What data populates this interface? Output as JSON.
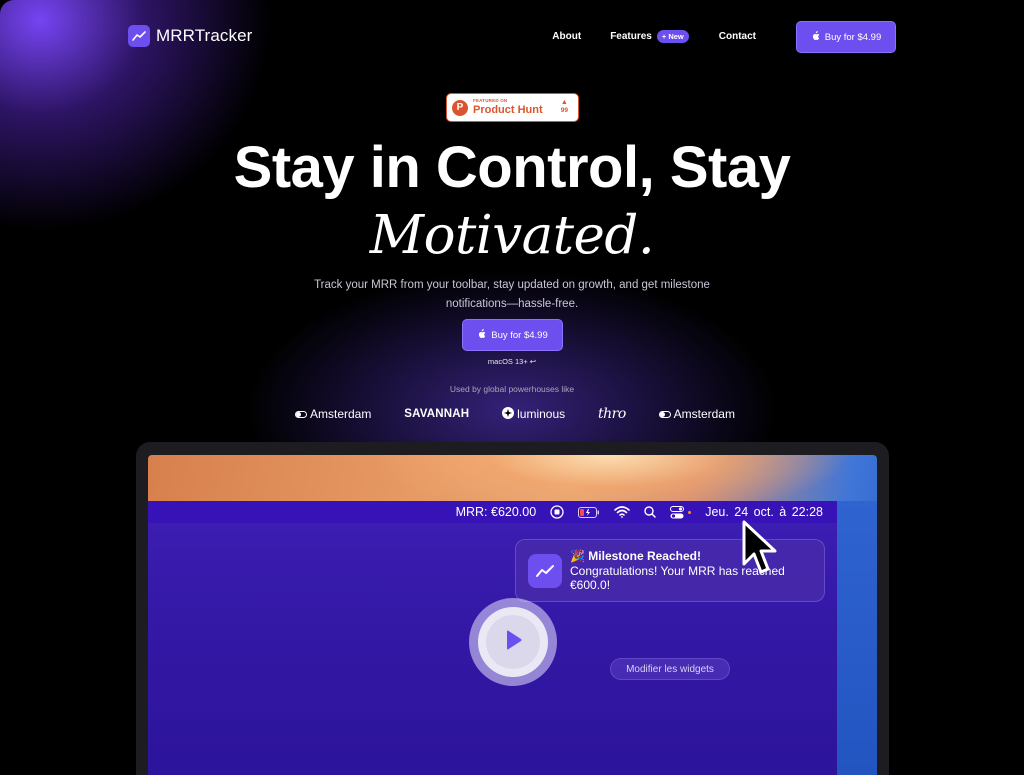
{
  "nav": {
    "logo_text": "MRRTracker",
    "about": "About",
    "features": "Features",
    "new_badge": "+ New",
    "contact": "Contact",
    "buy_label": "Buy for $4.99"
  },
  "product_hunt": {
    "featured_on": "FEATURED ON",
    "name": "Product Hunt",
    "votes": "99"
  },
  "hero": {
    "title": "Stay in Control, Stay",
    "title_accent": "Motivated.",
    "subtitle": "Track your MRR from your toolbar, stay updated on growth, and get milestone notifications—hassle-free.",
    "buy_label": "Buy for $4.99",
    "requirement": "macOS 13+ ↩"
  },
  "social_proof": {
    "caption": "Used by global powerhouses like",
    "brands": [
      "Amsterdam",
      "SAVANNAH",
      "luminous",
      "thro",
      "Amsterdam"
    ]
  },
  "device": {
    "menubar": {
      "mrr": "MRR: €620.00",
      "date": "Jeu. 24 oct. à  22:28"
    },
    "notification": {
      "title": "🎉 Milestone Reached!",
      "body": "Congratulations! Your MRR has reached €600.0!"
    },
    "widgets_button": "Modifier les widgets"
  },
  "colors": {
    "accent": "#6d4ff0",
    "product_hunt": "#da552f",
    "background": "#000000"
  }
}
